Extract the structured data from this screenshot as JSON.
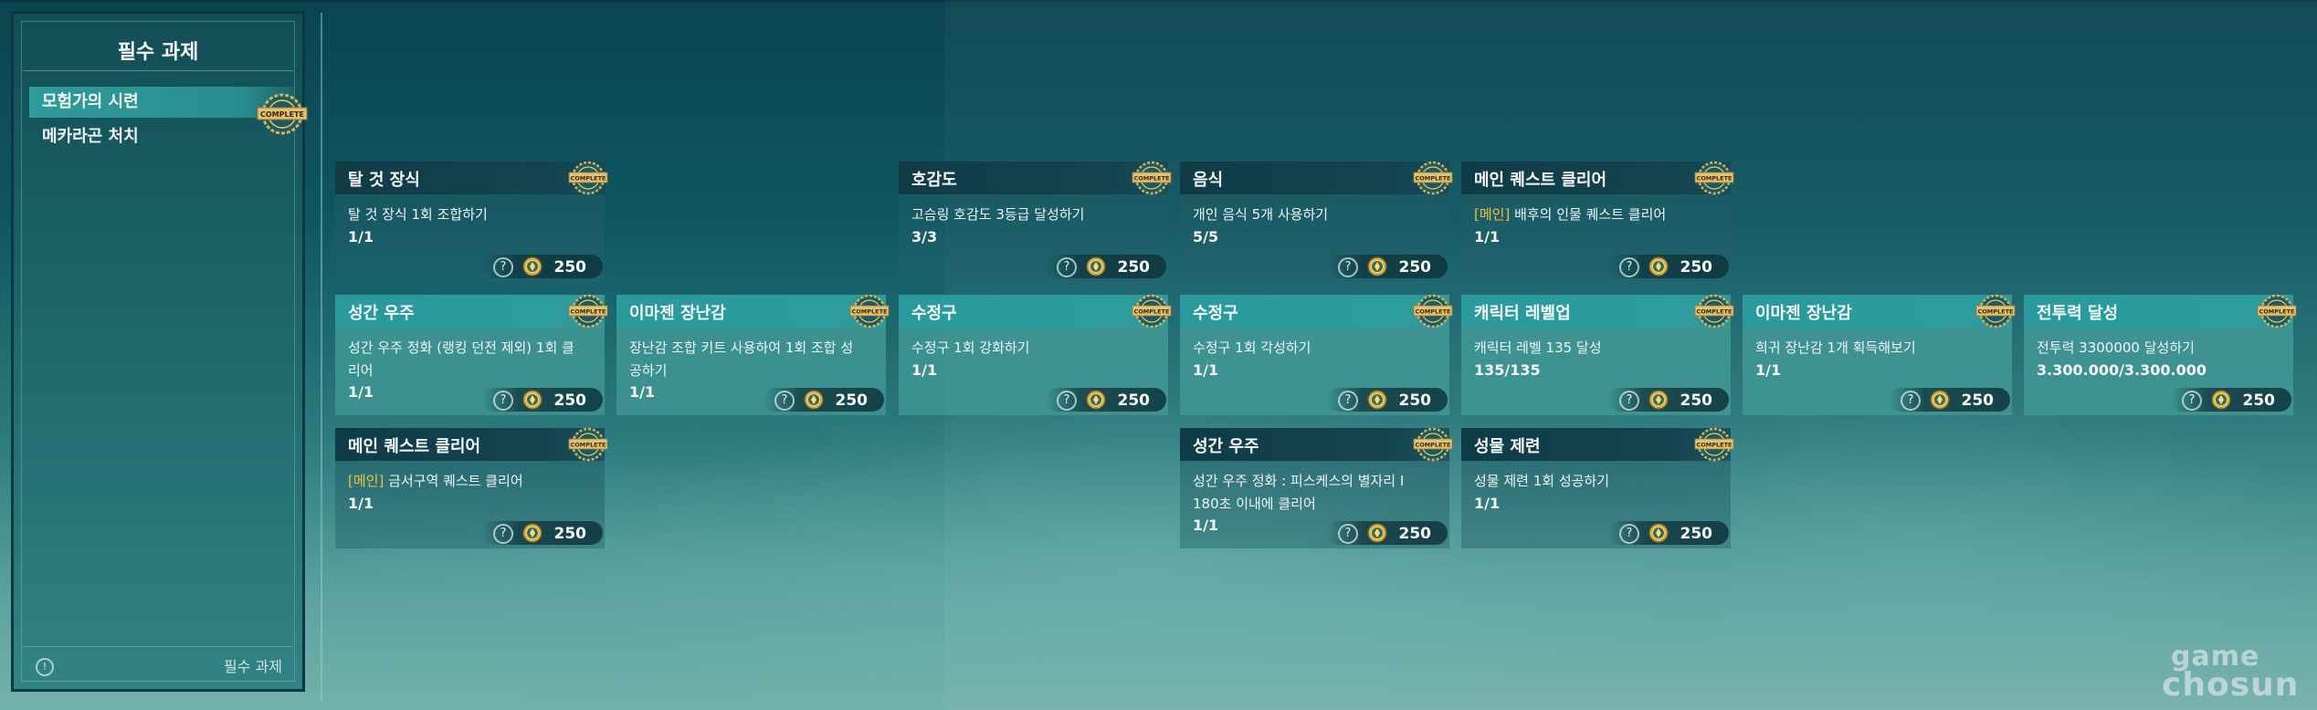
{
  "sidebar": {
    "title": "필수 과제",
    "items": [
      {
        "label": "모험가의 시련",
        "active": true
      },
      {
        "label": "메카라곤 처치",
        "active": false
      }
    ],
    "footer_label": "필수 과제",
    "info_glyph": "!",
    "badge_text": "COMPLETE"
  },
  "cards": [
    {
      "title": "탈 것 장식",
      "tag": "",
      "desc": "탈 것 장식 1회 조합하기",
      "progress": "1/1",
      "reward": "250",
      "style": "dark"
    },
    {
      "title": "호감도",
      "tag": "",
      "desc": "고슴링 호감도 3등급 달성하기",
      "progress": "3/3",
      "reward": "250",
      "style": "dark"
    },
    {
      "title": "음식",
      "tag": "",
      "desc": "개인 음식 5개 사용하기",
      "progress": "5/5",
      "reward": "250",
      "style": "dark"
    },
    {
      "title": "메인 퀘스트 클리어",
      "tag": "[메인]",
      "desc": " 배후의 인물 퀘스트 클리어",
      "progress": "1/1",
      "reward": "250",
      "style": "dark"
    },
    {
      "title": "성간 우주",
      "tag": "",
      "desc": "성간 우주 정화 (랭킹 던전 제외) 1회 클리어",
      "progress": "1/1",
      "reward": "250",
      "style": "light"
    },
    {
      "title": "이마젠 장난감",
      "tag": "",
      "desc": "장난감 조합 키트 사용하여 1회 조합 성공하기",
      "progress": "1/1",
      "reward": "250",
      "style": "light"
    },
    {
      "title": "수정구",
      "tag": "",
      "desc": "수정구 1회 강화하기",
      "progress": "1/1",
      "reward": "250",
      "style": "light"
    },
    {
      "title": "수정구",
      "tag": "",
      "desc": "수정구 1회 각성하기",
      "progress": "1/1",
      "reward": "250",
      "style": "light"
    },
    {
      "title": "캐릭터 레벨업",
      "tag": "",
      "desc": "캐릭터 레벨 135 달성",
      "progress": "135/135",
      "reward": "250",
      "style": "light"
    },
    {
      "title": "이마젠 장난감",
      "tag": "",
      "desc": "희귀 장난감 1개 획득해보기",
      "progress": "1/1",
      "reward": "250",
      "style": "light"
    },
    {
      "title": "전투력 달성",
      "tag": "",
      "desc": "전투력 3300000 달성하기",
      "progress": "3.300.000/3.300.000",
      "reward": "250",
      "style": "light"
    },
    {
      "title": "메인 퀘스트 클리어",
      "tag": "[메인]",
      "desc": " 금서구역 퀘스트 클리어",
      "progress": "1/1",
      "reward": "250",
      "style": "dark"
    },
    {
      "title": "성간 우주",
      "tag": "",
      "desc": "성간 우주 정화 : 피스케스의 별자리 I 180초 이내에 클리어",
      "progress": "1/1",
      "reward": "250",
      "style": "dark"
    },
    {
      "title": "성물 제련",
      "tag": "",
      "desc": "성물 제련 1회 성공하기",
      "progress": "1/1",
      "reward": "250",
      "style": "dark"
    }
  ],
  "watermark": {
    "line1": "game",
    "line2": "chosun"
  },
  "colors": {
    "accent_tag": "#f0c23c",
    "badge_gold": "#d8b25a",
    "header_dark": "#103c48",
    "header_light": "#2a9a9c"
  }
}
